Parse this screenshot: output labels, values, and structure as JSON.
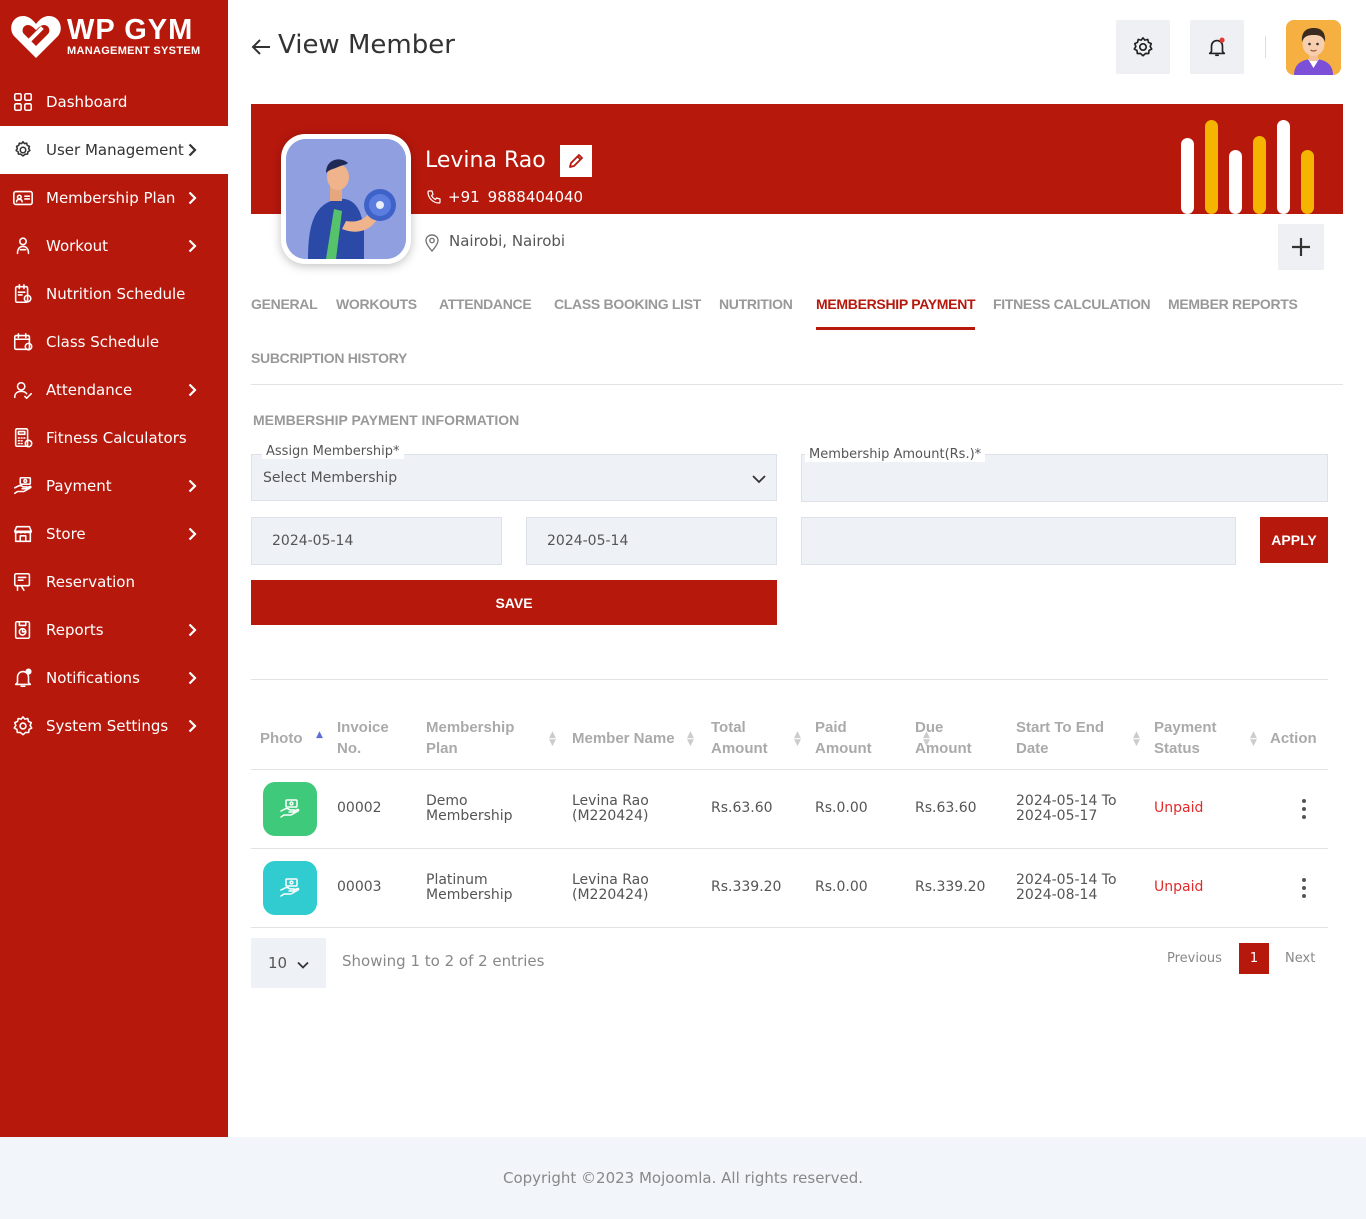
{
  "brand": {
    "title": "WP GYM",
    "subtitle": "MANAGEMENT SYSTEM"
  },
  "sidebar": {
    "items": [
      {
        "label": "Dashboard",
        "icon": "dashboard-icon",
        "chevron": false,
        "active": false
      },
      {
        "label": "User Management",
        "icon": "users-gear-icon",
        "chevron": true,
        "active": true
      },
      {
        "label": "Membership Plan",
        "icon": "membership-card-icon",
        "chevron": true,
        "active": false
      },
      {
        "label": "Workout",
        "icon": "workout-icon",
        "chevron": true,
        "active": false
      },
      {
        "label": "Nutrition Schedule",
        "icon": "nutrition-icon",
        "chevron": false,
        "active": false
      },
      {
        "label": "Class Schedule",
        "icon": "calendar-icon",
        "chevron": false,
        "active": false
      },
      {
        "label": "Attendance",
        "icon": "attendance-icon",
        "chevron": true,
        "active": false
      },
      {
        "label": "Fitness Calculators",
        "icon": "calculator-icon",
        "chevron": false,
        "active": false
      },
      {
        "label": "Payment",
        "icon": "payment-icon",
        "chevron": true,
        "active": false
      },
      {
        "label": "Store",
        "icon": "store-icon",
        "chevron": true,
        "active": false
      },
      {
        "label": "Reservation",
        "icon": "reservation-icon",
        "chevron": false,
        "active": false
      },
      {
        "label": "Reports",
        "icon": "reports-icon",
        "chevron": true,
        "active": false
      },
      {
        "label": "Notifications",
        "icon": "bell-icon",
        "chevron": true,
        "active": false
      },
      {
        "label": "System Settings",
        "icon": "gear-icon",
        "chevron": true,
        "active": false
      }
    ]
  },
  "header": {
    "title": "View Member"
  },
  "member": {
    "name": "Levina Rao",
    "phone_code": "+91",
    "phone": "9888404040",
    "address": "Nairobi, Nairobi"
  },
  "tabs": [
    {
      "label": "GENERAL",
      "active": false
    },
    {
      "label": "WORKOUTS",
      "active": false
    },
    {
      "label": "ATTENDANCE",
      "active": false
    },
    {
      "label": "CLASS BOOKING LIST",
      "active": false
    },
    {
      "label": "NUTRITION",
      "active": false
    },
    {
      "label": "MEMBERSHIP PAYMENT",
      "active": true
    },
    {
      "label": "FITNESS CALCULATION",
      "active": false
    },
    {
      "label": "MEMBER REPORTS",
      "active": false
    },
    {
      "label": "SUBCRIPTION HISTORY",
      "active": false
    }
  ],
  "form": {
    "section_title": "MEMBERSHIP PAYMENT INFORMATION",
    "assign_label": "Assign Membership*",
    "assign_value": "Select Membership",
    "amount_label": "Membership Amount(Rs.)*",
    "amount_value": "",
    "start_date": "2024-05-14",
    "end_date": "2024-05-14",
    "coupon_value": "",
    "apply_label": "APPLY",
    "save_label": "SAVE"
  },
  "table": {
    "columns": [
      {
        "line1": "Photo",
        "line2": ""
      },
      {
        "line1": "Invoice",
        "line2": "No."
      },
      {
        "line1": "Membership",
        "line2": "Plan"
      },
      {
        "line1": "Member Name",
        "line2": ""
      },
      {
        "line1": "Total",
        "line2": "Amount"
      },
      {
        "line1": "Paid",
        "line2": "Amount"
      },
      {
        "line1": "Due",
        "line2": "Amount"
      },
      {
        "line1": "Start To End",
        "line2": "Date"
      },
      {
        "line1": "Payment",
        "line2": "Status"
      },
      {
        "line1": "Action",
        "line2": ""
      }
    ],
    "rows": [
      {
        "icon": "payment-hand-icon",
        "icon_color": "#3fc97a",
        "invoice": "00002",
        "plan_1": "Demo",
        "plan_2": "Membership",
        "member_1": "Levina Rao",
        "member_2": "(M220424)",
        "total": "Rs.63.60",
        "paid": "Rs.0.00",
        "due": "Rs.63.60",
        "date_1": "2024-05-14 To",
        "date_2": "2024-05-17",
        "status": "Unpaid"
      },
      {
        "icon": "payment-hand-icon",
        "icon_color": "#31ccd0",
        "invoice": "00003",
        "plan_1": "Platinum",
        "plan_2": "Membership",
        "member_1": "Levina Rao",
        "member_2": "(M220424)",
        "total": "Rs.339.20",
        "paid": "Rs.0.00",
        "due": "Rs.339.20",
        "date_1": "2024-05-14 To",
        "date_2": "2024-08-14",
        "status": "Unpaid"
      }
    ],
    "page_length": "10",
    "info": "Showing 1 to 2 of 2 entries",
    "prev_label": "Previous",
    "page": "1",
    "next_label": "Next"
  },
  "footer": {
    "copyright": "Copyright ©2023 Mojoomla. All rights reserved."
  },
  "colors": {
    "brand_red": "#b7180c",
    "accent_yellow": "#f5b400",
    "unpaid": "#e32b2b"
  }
}
